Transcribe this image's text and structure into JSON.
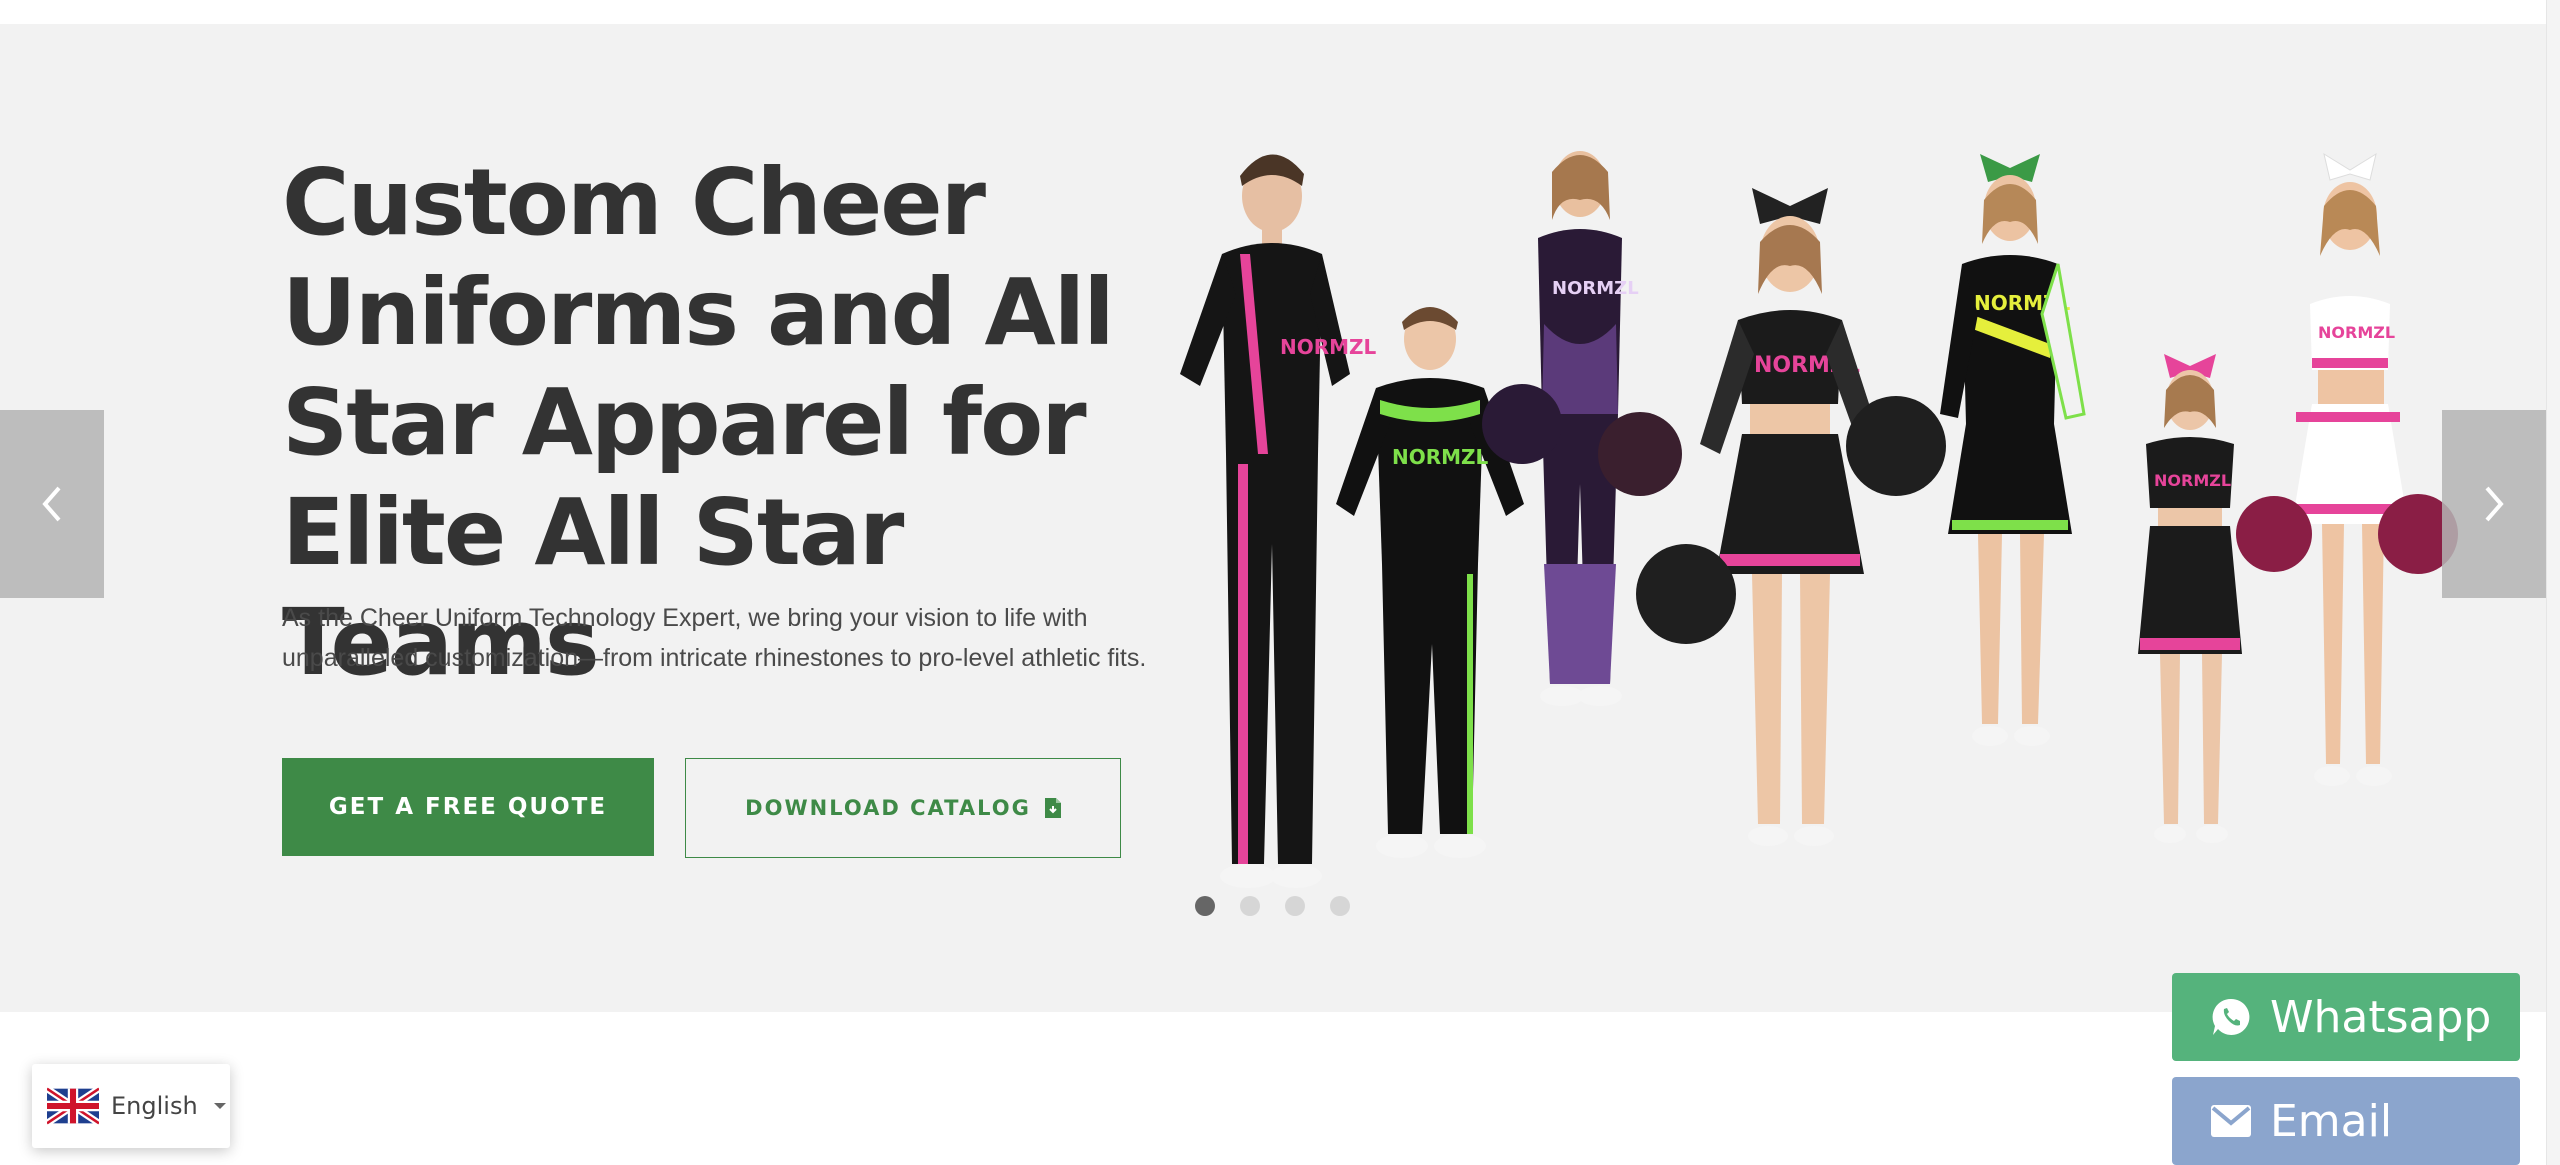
{
  "hero": {
    "title": "Custom Cheer Uniforms and All Star Apparel for Elite All Star Teams",
    "description": "As the Cheer Uniform Technology Expert, we bring your vision to life with unparalleled customization—from intricate rhinestones to pro-level athletic fits.",
    "primary_cta": "GET A FREE QUOTE",
    "secondary_cta": "DOWNLOAD CATALOG",
    "secondary_cta_icon": "document-download-icon",
    "slider": {
      "slide_count": 4,
      "active_index": 0
    },
    "uniform_brand_text": "NORMZL",
    "nav_icons": {
      "prev": "chevron-left-icon",
      "next": "chevron-right-icon"
    }
  },
  "language": {
    "current": "English",
    "flag_icon": "uk-flag-icon",
    "dropdown_icon": "caret-down-icon"
  },
  "contact": {
    "whatsapp_label": "Whatsapp",
    "whatsapp_icon": "whatsapp-icon",
    "email_label": "Email",
    "email_icon": "envelope-icon"
  },
  "colors": {
    "accent_green": "#3e8a47",
    "whatsapp_green": "#55b37c",
    "email_blue": "#8ba5cd",
    "hero_bg": "#f2f2f2",
    "title_text": "#333333",
    "uniform_pink": "#e6449a",
    "uniform_lime": "#7ee04a",
    "uniform_purple": "#5b3a7a"
  }
}
